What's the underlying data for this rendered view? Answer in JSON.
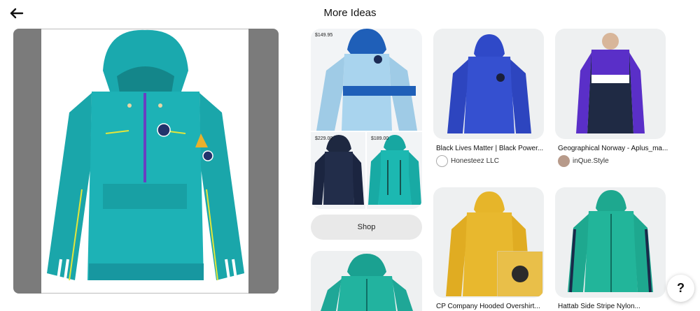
{
  "header": {
    "title": "More Ideas",
    "back_icon": "arrow-left-icon"
  },
  "shop_collage": {
    "prices": [
      "$149.95",
      "$229.00",
      "$189.00"
    ],
    "shop_label": "Shop"
  },
  "pins": [
    {
      "title": "Black Lives Matter | Black Power...",
      "creator": "Honesteez LLC"
    },
    {
      "title": "Geographical Norway - Aplus_ma...",
      "creator": "inQue.Style"
    },
    {
      "title": "CP Company Hooded Overshirt...",
      "creator": ""
    },
    {
      "title": "Hattab Side Stripe Nylon...",
      "creator": ""
    }
  ],
  "help": {
    "label": "?"
  },
  "colors": {
    "teal": "#1aa9ae",
    "royal_blue": "#2f49c8",
    "mustard": "#e6b52a",
    "navy": "#1f2a44",
    "light_blue": "#a9d4ee"
  }
}
